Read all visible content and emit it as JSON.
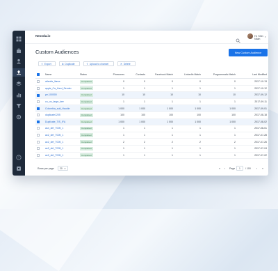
{
  "app": {
    "logo": "Nexoda.io"
  },
  "header": {
    "greeting": "Hi, Shin Nazh"
  },
  "page": {
    "title": "Custom Audiences",
    "new_button": "New Custom Audience"
  },
  "toolbar": {
    "export": "Export",
    "duplicate": "Duplicate",
    "upload": "Upload to channel",
    "delete": "Delete"
  },
  "table": {
    "columns": [
      "Name",
      "Status",
      "Pinecones",
      "Contacts",
      "Facebook Match",
      "LinkedIn Match",
      "Programmatic Match",
      "Last Modified"
    ],
    "rows": [
      {
        "name": "atlantis_llama",
        "status": "Completed",
        "pinecones": "0",
        "contacts": "0",
        "facebook": "0",
        "linkedin": "0",
        "programmatic": "0",
        "modified": "2017-10-13",
        "selected": false
      },
      {
        "name": "apple_Ca_Hard_Sender",
        "status": "Completed",
        "pinecones": "1",
        "contacts": "1",
        "facebook": "1",
        "linkedin": "1",
        "programmatic": "1",
        "modified": "2017-10-12",
        "selected": false
      },
      {
        "name": "pe-100000",
        "status": "Completed",
        "pinecones": "10",
        "contacts": "10",
        "facebook": "10",
        "linkedin": "10",
        "programmatic": "10",
        "modified": "2017-09-12",
        "selected": true
      },
      {
        "name": "co_on_large_kee",
        "status": "Completed",
        "pinecones": "1",
        "contacts": "1",
        "facebook": "1",
        "linkedin": "1",
        "programmatic": "1",
        "modified": "2017-09-11",
        "selected": false
      },
      {
        "name": "Colombia_ault_Haudie",
        "status": "Completed",
        "pinecones": "1 000",
        "contacts": "1 000",
        "facebook": "1 000",
        "linkedin": "1 000",
        "programmatic": "1 000",
        "modified": "2017-09-01",
        "selected": true
      },
      {
        "name": "duplicate1205",
        "status": "Completed",
        "pinecones": "100",
        "contacts": "100",
        "facebook": "100",
        "linkedin": "100",
        "programmatic": "100",
        "modified": "2017-08-18",
        "selected": false
      },
      {
        "name": "Duplicate_TIS_IFA",
        "status": "Completed",
        "pinecones": "1 000",
        "contacts": "1 000",
        "facebook": "1 000",
        "linkedin": "1 000",
        "programmatic": "1 000",
        "modified": "2017-08-02",
        "selected": true
      },
      {
        "name": "asn_def_T005_1",
        "status": "Completed",
        "pinecones": "1",
        "contacts": "1",
        "facebook": "1",
        "linkedin": "1",
        "programmatic": "1",
        "modified": "2017-08-01",
        "selected": false
      },
      {
        "name": "ac2_def_T005_1",
        "status": "Completed",
        "pinecones": "1",
        "contacts": "1",
        "facebook": "1",
        "linkedin": "1",
        "programmatic": "1",
        "modified": "2017-07-28",
        "selected": false
      },
      {
        "name": "ac2_def_T005_1",
        "status": "Completed",
        "pinecones": "2",
        "contacts": "2",
        "facebook": "2",
        "linkedin": "2",
        "programmatic": "2",
        "modified": "2017-07-26",
        "selected": false
      },
      {
        "name": "ac2_def_T005_1",
        "status": "Completed",
        "pinecones": "1",
        "contacts": "1",
        "facebook": "1",
        "linkedin": "1",
        "programmatic": "1",
        "modified": "2017-07-24",
        "selected": false
      },
      {
        "name": "ac2_def_T005_1",
        "status": "Completed",
        "pinecones": "1",
        "contacts": "1",
        "facebook": "1",
        "linkedin": "1",
        "programmatic": "1",
        "modified": "2017-07-22",
        "selected": false
      }
    ]
  },
  "footer": {
    "rows_label": "Rows per page",
    "rows_value": "20",
    "page_label": "Page",
    "page_value": "1",
    "page_total": "/ 100",
    "first": "«",
    "prev": "‹",
    "next": "›",
    "last": "»"
  },
  "colors": {
    "accent": "#1a73e8",
    "sidebar": "#1e2a3a",
    "status_bg": "#d7ecdf"
  },
  "sidebar": {
    "icons": [
      "grid-icon",
      "briefcase-icon",
      "user-icon",
      "upload-icon",
      "layers-icon",
      "chart-icon",
      "filter-icon",
      "settings-icon",
      "help-icon",
      "logout-icon"
    ],
    "active_index": 3
  }
}
